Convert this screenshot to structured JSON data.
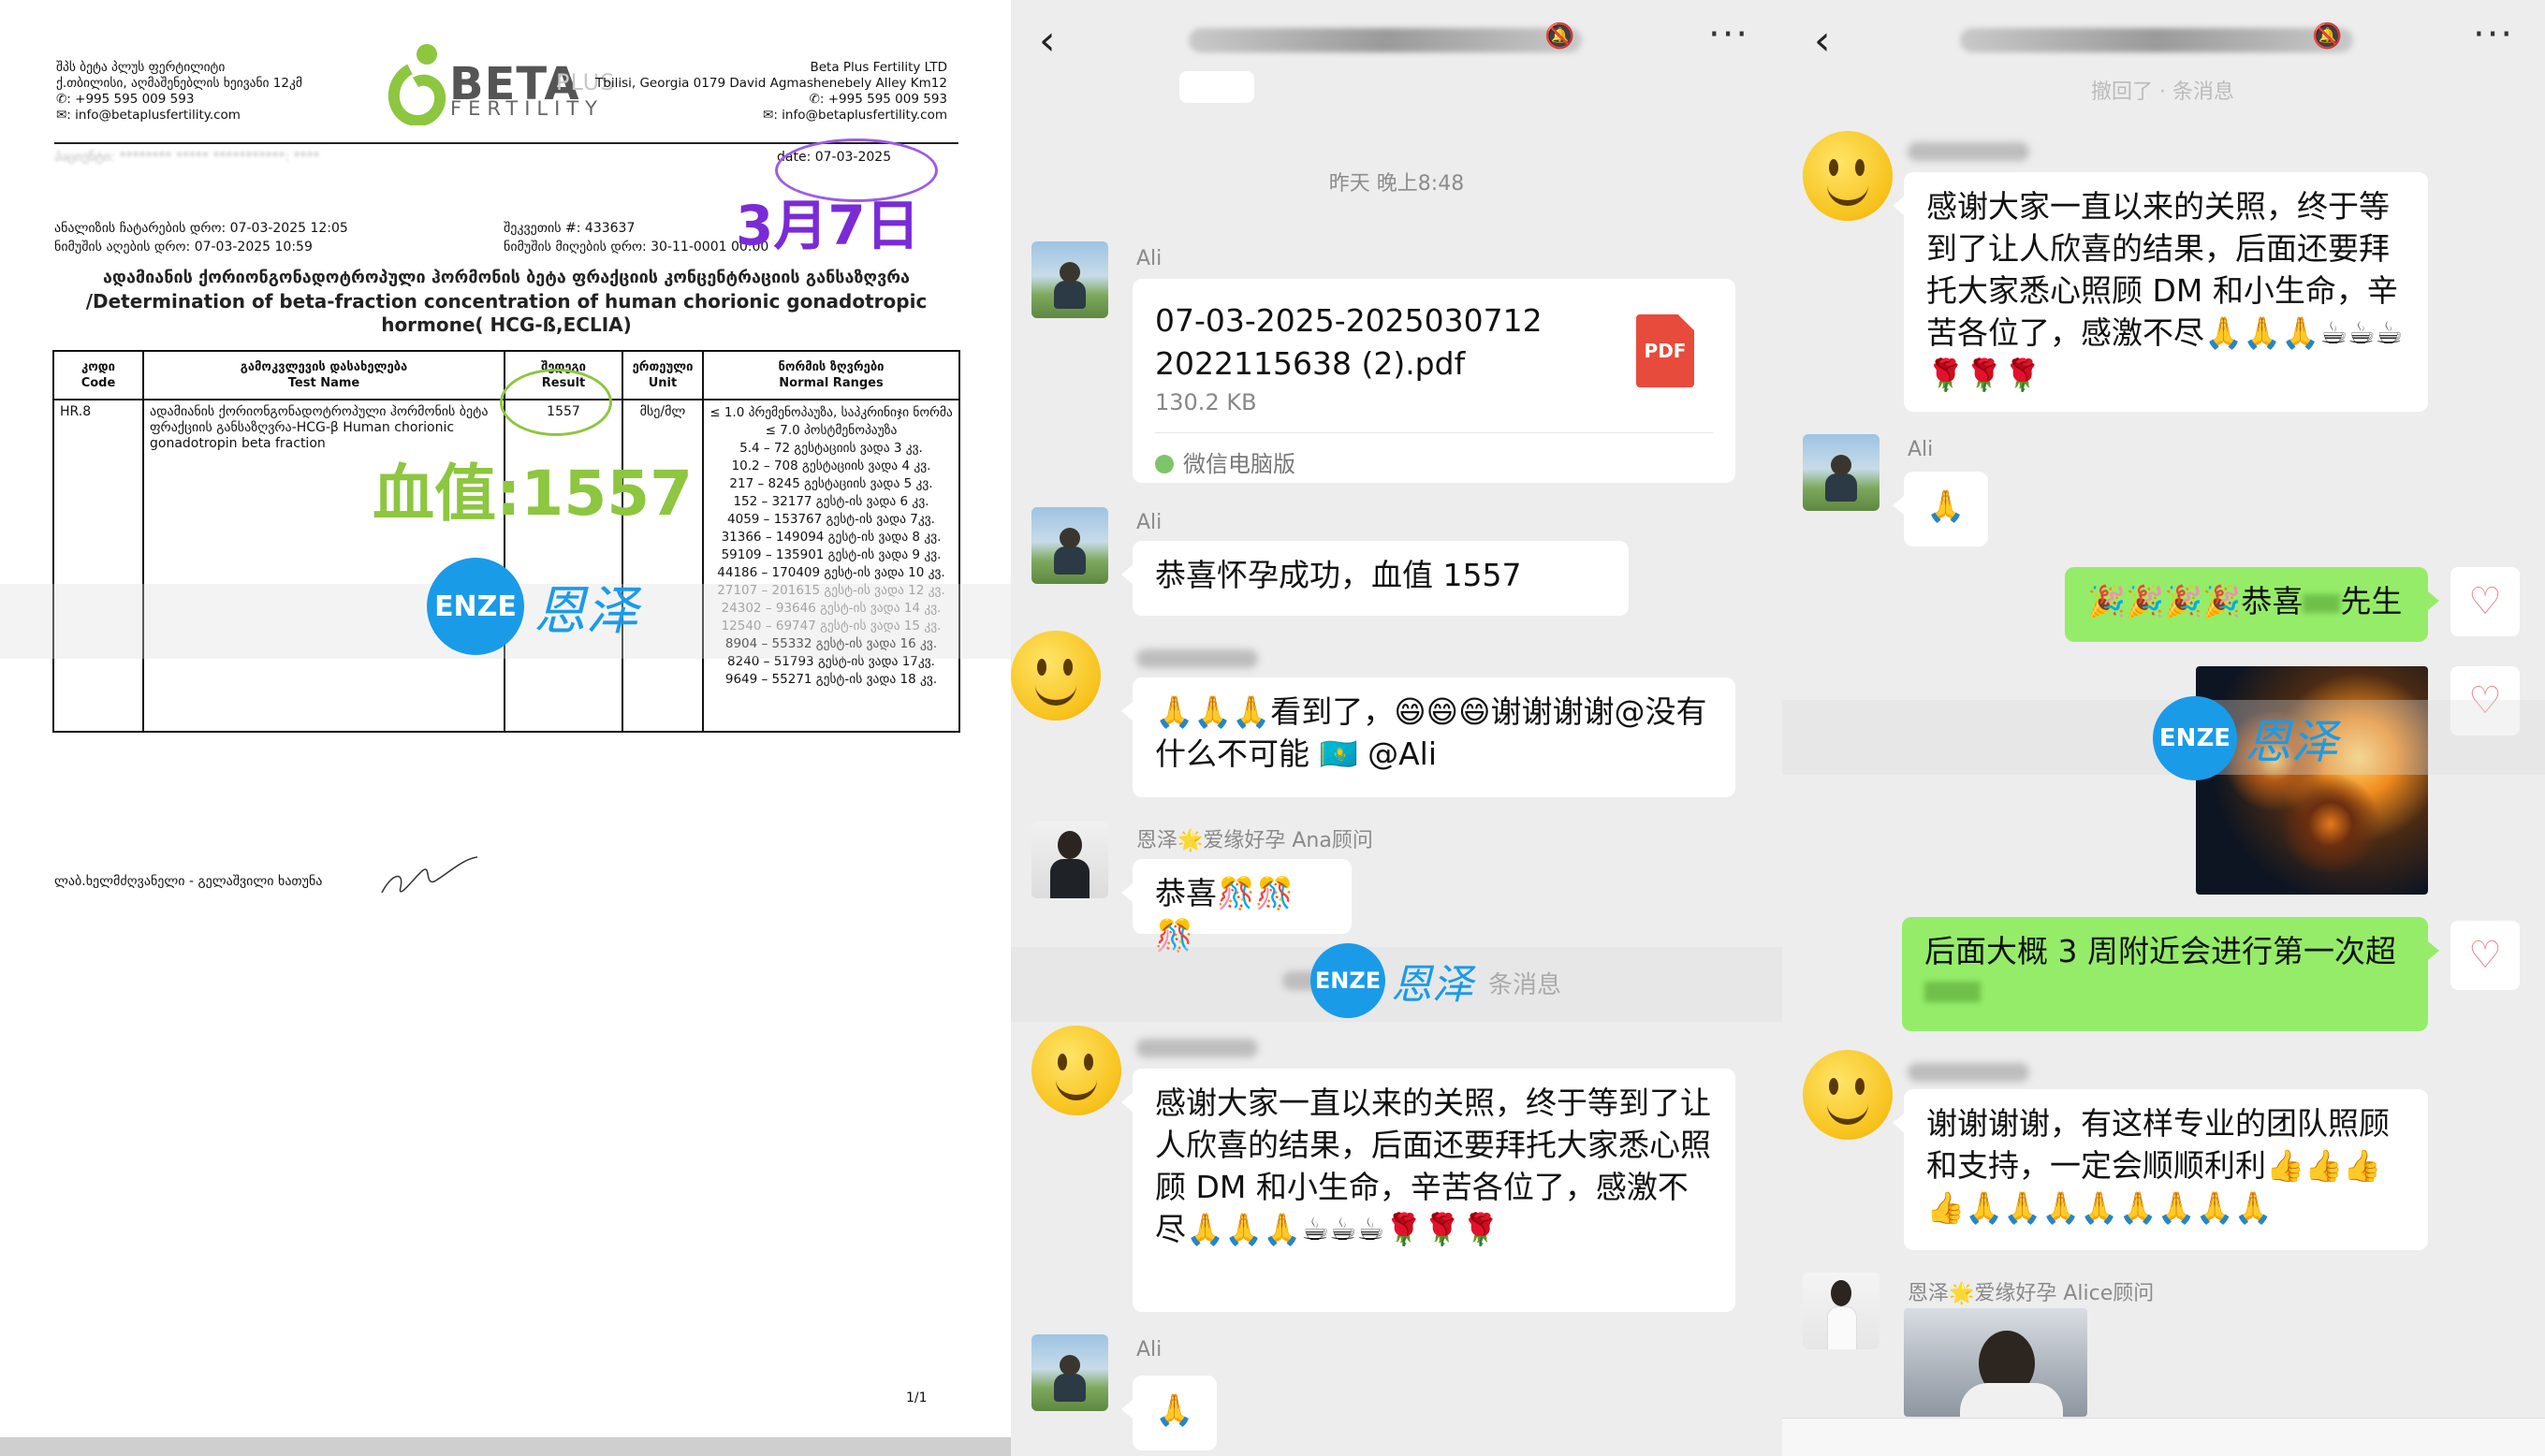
{
  "document": {
    "header_left_lines": [
      "შპს ბეტა პლუს ფერტილიტი",
      "ქ.თბილისი, აღმაშენებლის ხეივანი 12კმ",
      "✆: +995 595 009 593",
      "✉: info@betaplusfertility.com"
    ],
    "logo_main": "BETA",
    "logo_plus": "PLUS",
    "logo_sub": "FERTILITY",
    "header_right_lines": [
      "Beta Plus Fertility LTD",
      "Tbilisi, Georgia 0179 David Agmashenebely Alley Km12",
      "✆: +995 595 009 593",
      "✉: info@betaplusfertility.com"
    ],
    "patient_line": "პაციენტი: ******** ***** ***********: ****",
    "date_label": "date: 07-03-2025",
    "info_line1_left": "ანალიზის ჩატარების დრო: 07-03-2025 12:05",
    "info_line1_right": "შეკვეთის #: 433637",
    "info_line2_left": "ნიმუშის აღების დრო: 07-03-2025 10:59",
    "info_line2_right": "ნიმუშის მიღების დრო: 30-11-0001 00:00",
    "title_ge": "ადამიანის ქორიონგონადოტროპული ჰორმონის ბეტა ფრაქციის კონცენტრაციის განსაზღვრა",
    "title_en_1": "/Determination of beta-fraction concentration of human chorionic gonadotropic",
    "title_en_2": "hormone( HCG-ß,ECLIA)",
    "table_headers": [
      {
        "ge": "კოდი",
        "en": "Code"
      },
      {
        "ge": "გამოკვლევის დასახელება",
        "en": "Test Name"
      },
      {
        "ge": "შედეგი",
        "en": "Result"
      },
      {
        "ge": "ერთეული",
        "en": "Unit"
      },
      {
        "ge": "ნორმის ზღვრები",
        "en": "Normal Ranges"
      }
    ],
    "row_code": "HR.8",
    "row_name": "ადამიანის ქორიონგონადოტროპული ჰორმონის ბეტა ფრაქციის განსაზღვრა-HCG-β Human chorionic gonadotropin beta fraction",
    "row_result": "1557",
    "row_unit": "მსე/მლ",
    "ranges": [
      "≤ 1.0 პრემენოპაუზა, საპკრინიჯი ნორმა",
      "≤ 7.0 პოსტმენოპაუზა",
      "5.4 – 72 გესტაციის ვადა 3 კვ.",
      "10.2 – 708 გესტაციის ვადა 4 კვ.",
      "217 – 8245 გესტაციის ვადა 5 კვ.",
      "152 – 32177 გესტ-ის ვადა 6 კვ.",
      "4059 – 153767 გესტ-ის ვადა 7კვ.",
      "31366 – 149094 გესტ-ის ვადა 8 კვ.",
      "59109 – 135901 გესტ-ის ვადა 9 კვ.",
      "44186 – 170409 გესტ-ის ვადა 10 კვ.",
      "27107 – 201615 გესტ-ის ვადა 12 კვ.",
      "24302 – 93646 გესტ-ის ვადა 14 კვ.",
      "12540 – 69747 გესტ-ის ვადა 15 კვ.",
      "8904 – 55332 გესტ-ის ვადა 16 კვ.",
      "8240 – 51793 გესტ-ის ვადა 17კვ.",
      "9649 – 55271 გესტ-ის ვადა 18 კვ."
    ],
    "annotation_date": "3月7日",
    "annotation_value": "血值:1557",
    "signature_line": "ლაბ.ხელმძღვანელი - გელაშვილი ხათუნა",
    "page_number": "1/1",
    "enze_badge": "ENZE",
    "enze_cn": "恩泽"
  },
  "chat1": {
    "back_glyph": "‹",
    "more_glyph": "···",
    "timestamp": "昨天 晚上8:48",
    "ali_name": "Ali",
    "file_name": "07-03-2025-20250307122022115638 (2).pdf",
    "file_size": "130.2 KB",
    "file_icon_label": "PDF",
    "file_source": "微信电脑版",
    "msg_ali_congrats": "恭喜怀孕成功，血值 1557",
    "msg_reply1_emoji": "🙏🙏🙏",
    "msg_reply1_text": "看到了，",
    "msg_reply1_emoji2": "😄😄😄",
    "msg_reply1_text2": "谢谢谢谢@没有什么不可能 ",
    "msg_reply1_flag": "🇰🇿",
    "msg_reply1_mention": " @Ali",
    "ana_name": "恩泽🌟爱缘好孕 Ana顾问",
    "msg_ana": "恭喜🎊🎊🎊",
    "unread_text": "条消息",
    "msg_thanks": "感谢大家一直以来的关照，终于等到了让人欣喜的结果，后面还要拜托大家悉心照顾 DM 和小生命，辛苦各位了，感激不尽🙏🙏🙏☕☕☕🌹🌹🌹",
    "msg_ali_emoji": "🙏"
  },
  "chat2": {
    "back_glyph": "‹",
    "more_glyph": "···",
    "top_faded": "撤回了  · 条消息",
    "msg_thanks": "感谢大家一直以来的关照，终于等到了让人欣喜的结果，后面还要拜托大家悉心照顾 DM 和小生命，辛苦各位了，感激不尽🙏🙏🙏☕☕☕🌹🌹🌹",
    "ali_name": "Ali",
    "msg_ali_emoji": "🙏",
    "msg_me_congrats_emoji": "🎉🎉🎉🎉",
    "msg_me_congrats_text": "恭喜",
    "msg_me_congrats_suffix": "先生",
    "msg_me_scan": "后面大概 3 周附近会进行第一次超",
    "msg_reply": "谢谢谢谢，有这样专业的团队照顾和支持，一定会顺顺利利👍👍👍👍🙏🙏🙏🙏🙏🙏🙏🙏",
    "alice_name": "恩泽🌟爱缘好孕 Alice顾问",
    "enze_badge": "ENZE",
    "enze_cn": "恩泽"
  }
}
